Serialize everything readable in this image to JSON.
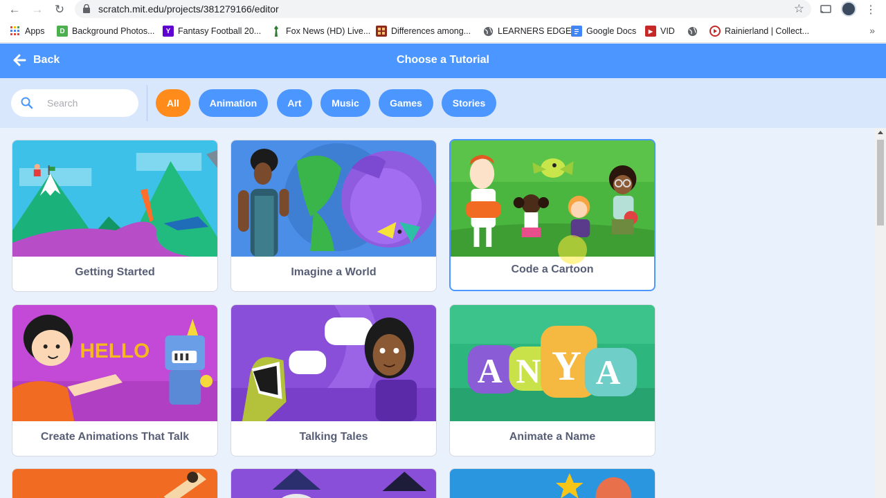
{
  "browser": {
    "url": "scratch.mit.edu/projects/381279166/editor",
    "bookmarks": [
      {
        "label": "Apps",
        "icon": "apps-grid-icon",
        "color": "#1a73e8"
      },
      {
        "label": "Background Photos...",
        "icon": "d-icon",
        "color": "#4caf50"
      },
      {
        "label": "Fantasy Football 20...",
        "icon": "yahoo-icon",
        "color": "#5f01d1"
      },
      {
        "label": "Fox News (HD) Live...",
        "icon": "fox-figure-icon",
        "color": "#2e7d32"
      },
      {
        "label": "Differences among...",
        "icon": "grid-thumbnail-icon",
        "color": "#8d2a1c"
      },
      {
        "label": "LEARNERS EDGE",
        "icon": "globe-icon",
        "color": "#5f6368"
      },
      {
        "label": "Google Docs",
        "icon": "docs-icon",
        "color": "#4285f4"
      },
      {
        "label": "VID",
        "icon": "vid-icon",
        "color": "#c62828"
      },
      {
        "label": "",
        "icon": "globe-icon",
        "color": "#5f6368"
      },
      {
        "label": "Rainierland | Collect...",
        "icon": "play-circle-icon",
        "color": "#c62828"
      }
    ]
  },
  "header": {
    "back_label": "Back",
    "title": "Choose a Tutorial"
  },
  "search": {
    "placeholder": "Search"
  },
  "tags": [
    {
      "label": "All",
      "active": true
    },
    {
      "label": "Animation",
      "active": false
    },
    {
      "label": "Art",
      "active": false
    },
    {
      "label": "Music",
      "active": false
    },
    {
      "label": "Games",
      "active": false
    },
    {
      "label": "Stories",
      "active": false
    }
  ],
  "tutorials": [
    {
      "title": "Getting Started"
    },
    {
      "title": "Imagine a World"
    },
    {
      "title": "Code a Cartoon",
      "selected": true
    },
    {
      "title": "Create Animations That Talk"
    },
    {
      "title": "Talking Tales"
    },
    {
      "title": "Animate a Name"
    },
    {
      "title": ""
    },
    {
      "title": ""
    },
    {
      "title": ""
    }
  ],
  "artwork_text": {
    "hello": "HELLO",
    "anya": [
      "A",
      "N",
      "Y",
      "A"
    ]
  },
  "colors": {
    "scratch_blue": "#4c97ff",
    "active_tag": "#ff8c1a",
    "card_text": "#575e75"
  }
}
